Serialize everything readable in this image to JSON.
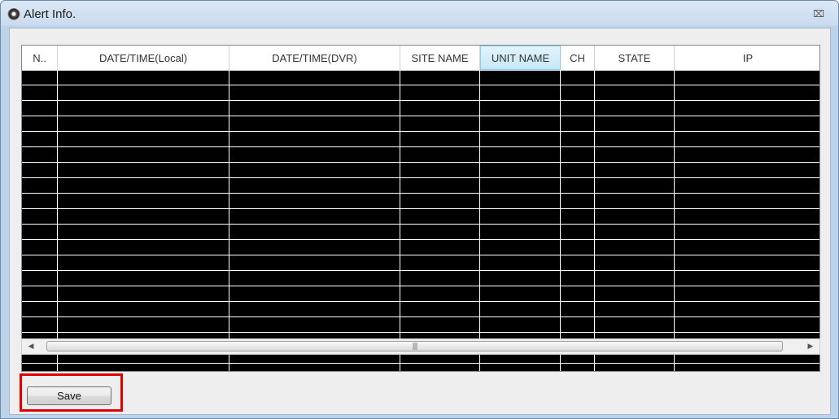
{
  "window": {
    "title": "Alert Info.",
    "close_symbol": "⌧"
  },
  "table": {
    "columns": [
      {
        "label": "N.."
      },
      {
        "label": "DATE/TIME(Local)"
      },
      {
        "label": "DATE/TIME(DVR)"
      },
      {
        "label": "SITE NAME"
      },
      {
        "label": "UNIT NAME",
        "active": true
      },
      {
        "label": "CH"
      },
      {
        "label": "STATE"
      },
      {
        "label": "IP"
      }
    ],
    "rows": []
  },
  "scrollbar": {
    "left_arrow": "◀",
    "right_arrow": "▶",
    "grip": "|||"
  },
  "buttons": {
    "save_label": "Save"
  },
  "colors": {
    "highlight": "#e00000",
    "list_background": "#000000",
    "active_header": "#c7e7f8"
  }
}
